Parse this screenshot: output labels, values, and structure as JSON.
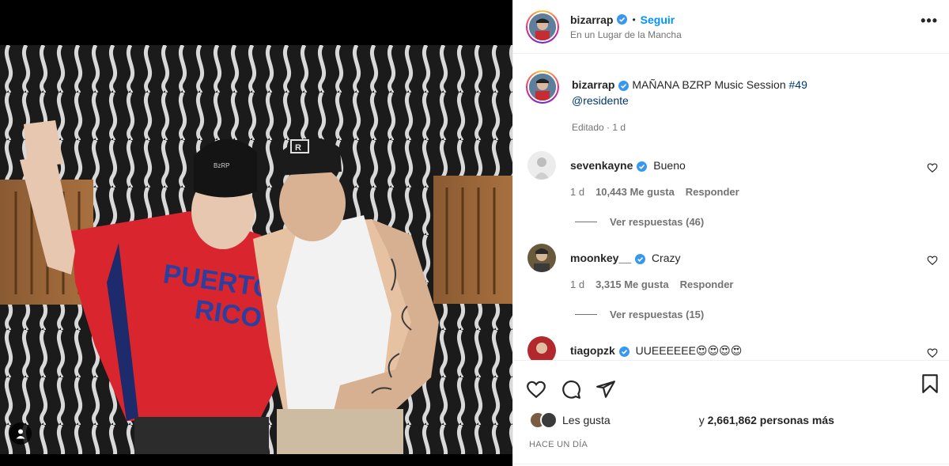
{
  "header": {
    "username": "bizarrap",
    "separator": "•",
    "follow_label": "Seguir",
    "location": "En un Lugar de la Mancha",
    "more_label": "•••"
  },
  "caption": {
    "username": "bizarrap",
    "text": "MAÑANA BZRP Music Session",
    "hashtag": "#49",
    "mention": "@residente",
    "meta": "Editado · 1 d"
  },
  "comments": [
    {
      "username": "sevenkayne",
      "text": "Bueno",
      "time": "1 d",
      "likes": "10,443 Me gusta",
      "reply": "Responder",
      "replies": "Ver respuestas (46)"
    },
    {
      "username": "moonkey__",
      "text": "Crazy",
      "time": "1 d",
      "likes": "3,315 Me gusta",
      "reply": "Responder",
      "replies": "Ver respuestas (15)"
    },
    {
      "username": "tiagopzk",
      "text": "UUEEEEEE😍😍😍😍"
    }
  ],
  "likes": {
    "prefix": "Les gusta",
    "suffix": "y",
    "count": "2,661,862 personas más"
  },
  "time_ago": "HACE UN DÍA",
  "colors": {
    "accent": "#0095f6",
    "link": "#00376b",
    "muted": "#737373",
    "verified": "#3897f0"
  },
  "icons": [
    "verified-icon",
    "more-icon",
    "heart-icon",
    "comment-icon",
    "share-icon",
    "save-icon",
    "user-tag-icon"
  ]
}
